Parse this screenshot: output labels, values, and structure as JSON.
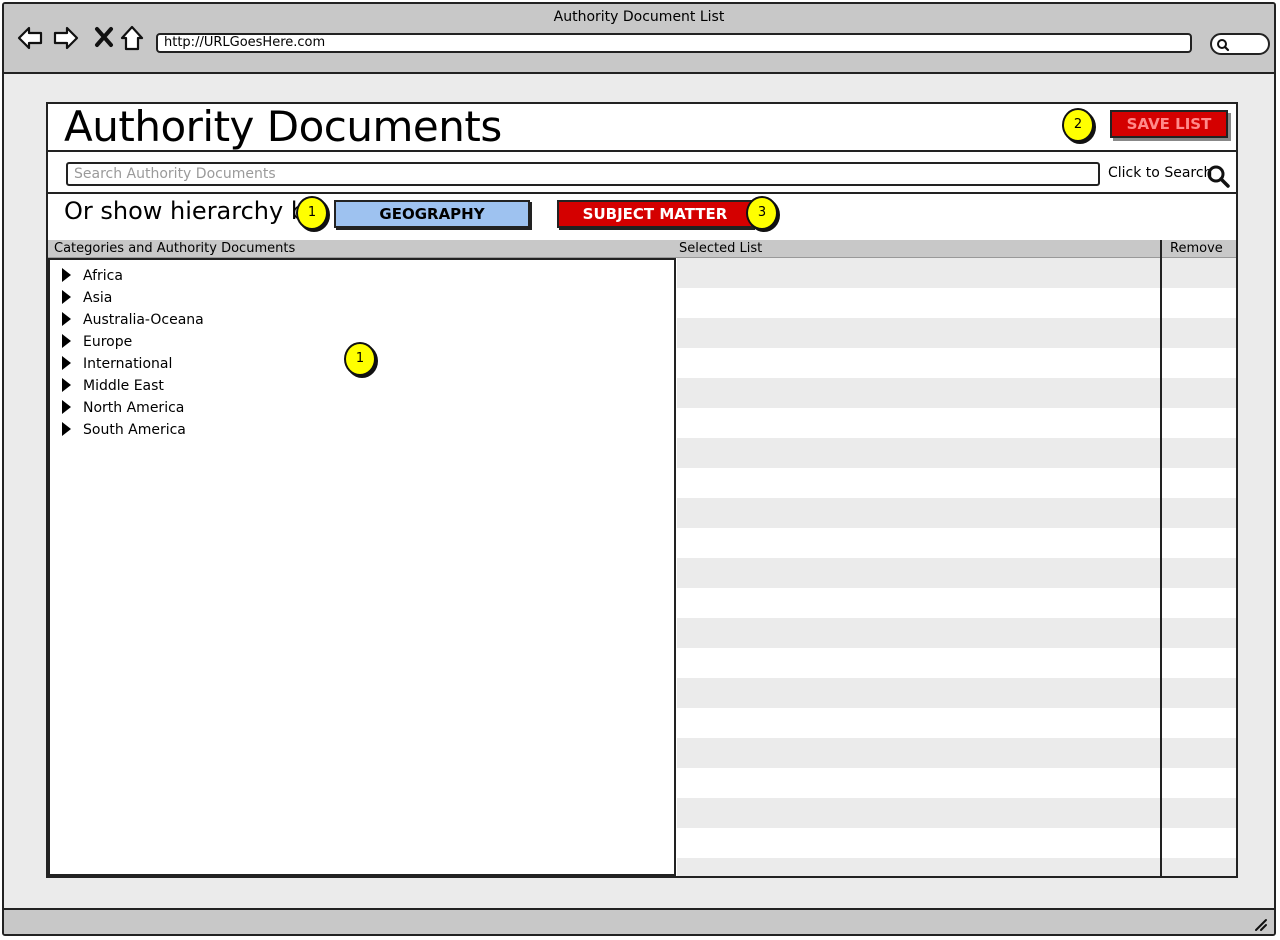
{
  "window": {
    "title": "Authority Document List"
  },
  "browser": {
    "url": "http://URLGoesHere.com"
  },
  "header": {
    "title": "Authority Documents",
    "save_label": "SAVE LIST"
  },
  "search": {
    "placeholder": "Search Authority Documents",
    "value": "",
    "link_label": "Click to Search"
  },
  "hierarchy": {
    "label": "Or show hierarchy by",
    "geography_label": "GEOGRAPHY",
    "subject_label": "SUBJECT MATTER"
  },
  "table": {
    "columns": [
      "Categories and Authority Documents",
      "Selected List",
      "Remove"
    ],
    "categories": [
      "Africa",
      "Asia",
      "Australia-Oceana",
      "Europe",
      "International",
      "Middle East",
      "North America",
      "South America"
    ]
  },
  "callouts": [
    "1",
    "2",
    "3",
    "1"
  ],
  "colors": {
    "save": "#d40000",
    "geography": "#9ec2f0",
    "subject": "#d40000",
    "callout": "#ffff00"
  }
}
